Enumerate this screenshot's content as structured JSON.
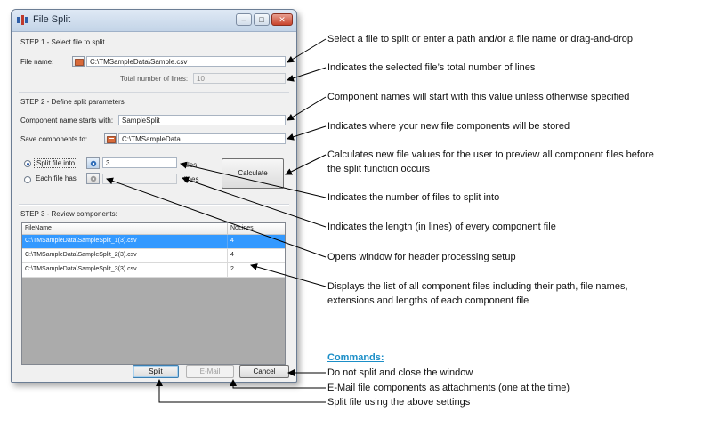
{
  "window": {
    "title": "File Split",
    "minimize_glyph": "–",
    "maximize_glyph": "□",
    "close_glyph": "✕"
  },
  "step1": {
    "heading": "STEP 1 - Select file to split",
    "file_name_label": "File name:",
    "file_name_value": "C:\\TMSampleData\\Sample.csv",
    "total_lines_label": "Total number of lines:",
    "total_lines_value": "10"
  },
  "step2": {
    "heading": "STEP 2 - Define split parameters",
    "component_name_label": "Component name starts with:",
    "component_name_value": "SampleSplit",
    "save_to_label": "Save components to:",
    "save_to_value": "C:\\TMSampleData",
    "split_into_label": "Split file into",
    "split_into_value": "3",
    "files_unit": "files",
    "each_file_label": "Each file has",
    "each_file_value": "",
    "lines_unit": "lines",
    "calculate_label": "Calculate"
  },
  "step3": {
    "heading": "STEP 3 - Review components:",
    "columns": [
      "FileName",
      "NoLines"
    ],
    "rows": [
      {
        "file": "C:\\TMSampleData\\SampleSplit_1(3).csv",
        "lines": "4"
      },
      {
        "file": "C:\\TMSampleData\\SampleSplit_2(3).csv",
        "lines": "4"
      },
      {
        "file": "C:\\TMSampleData\\SampleSplit_3(3).csv",
        "lines": "2"
      }
    ]
  },
  "buttons": {
    "split": "Split",
    "email": "E-Mail",
    "cancel": "Cancel"
  },
  "annotations": {
    "select_file": "Select a file to split or enter a path and/or a file name or drag-and-drop",
    "total_lines": "Indicates the selected file’s total number of lines",
    "component_names": "Component names will start with this value unless otherwise specified",
    "save_location": "Indicates where your new file components will be stored",
    "calculate_1": "Calculates new file values for the user to preview all component files before",
    "calculate_2": "the split function occurs",
    "num_files": "Indicates the number of files to split into",
    "length_lines": "Indicates the length (in lines) of every component file",
    "header_setup": "Opens window for header processing setup",
    "list_1": "Displays the list of all component files including their path, file names,",
    "list_2": "extensions and lengths of each component file",
    "commands_heading": "Commands:",
    "cancel_desc": "Do not split and close the window",
    "email_desc": "E-Mail file components as attachments (one at the time)",
    "split_desc": "Split file using the above settings"
  },
  "colors": {
    "selection": "#3399ff",
    "commands_heading": "#1b8ec7"
  }
}
